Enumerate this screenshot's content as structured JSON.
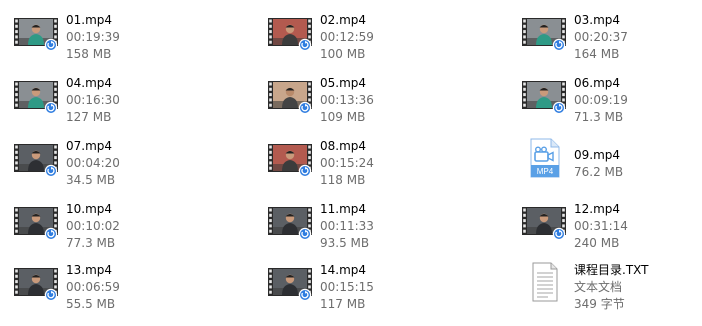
{
  "files": [
    {
      "name": "01.mp4",
      "line2": "00:19:39",
      "line3": "158 MB",
      "kind": "video",
      "scene": "teal"
    },
    {
      "name": "02.mp4",
      "line2": "00:12:59",
      "line3": "100 MB",
      "kind": "video",
      "scene": "red"
    },
    {
      "name": "03.mp4",
      "line2": "00:20:37",
      "line3": "164 MB",
      "kind": "video",
      "scene": "teal"
    },
    {
      "name": "04.mp4",
      "line2": "00:16:30",
      "line3": "127 MB",
      "kind": "video",
      "scene": "teal"
    },
    {
      "name": "05.mp4",
      "line2": "00:13:36",
      "line3": "109 MB",
      "kind": "video",
      "scene": "warm"
    },
    {
      "name": "06.mp4",
      "line2": "00:09:19",
      "line3": "71.3 MB",
      "kind": "video",
      "scene": "teal"
    },
    {
      "name": "07.mp4",
      "line2": "00:04:20",
      "line3": "34.5 MB",
      "kind": "video",
      "scene": "dark"
    },
    {
      "name": "08.mp4",
      "line2": "00:15:24",
      "line3": "118 MB",
      "kind": "video",
      "scene": "red"
    },
    {
      "name": "09.mp4",
      "line2": "76.2 MB",
      "line3": "",
      "kind": "mp4-icon",
      "badge": "MP4"
    },
    {
      "name": "10.mp4",
      "line2": "00:10:02",
      "line3": "77.3 MB",
      "kind": "video",
      "scene": "dark"
    },
    {
      "name": "11.mp4",
      "line2": "00:11:33",
      "line3": "93.5 MB",
      "kind": "video",
      "scene": "dark"
    },
    {
      "name": "12.mp4",
      "line2": "00:31:14",
      "line3": "240 MB",
      "kind": "video",
      "scene": "dark"
    },
    {
      "name": "13.mp4",
      "line2": "00:06:59",
      "line3": "55.5 MB",
      "kind": "video",
      "scene": "dark"
    },
    {
      "name": "14.mp4",
      "line2": "00:15:15",
      "line3": "117 MB",
      "kind": "video",
      "scene": "dark"
    },
    {
      "name": "课程目录.TXT",
      "line2": "文本文档",
      "line3": "349 字节",
      "kind": "text-icon"
    }
  ],
  "colors": {
    "filename": "#000000",
    "meta": "#6d6d6d",
    "mp4_icon": "#5aa0e6",
    "overlay_badge": "#2f7de0"
  }
}
